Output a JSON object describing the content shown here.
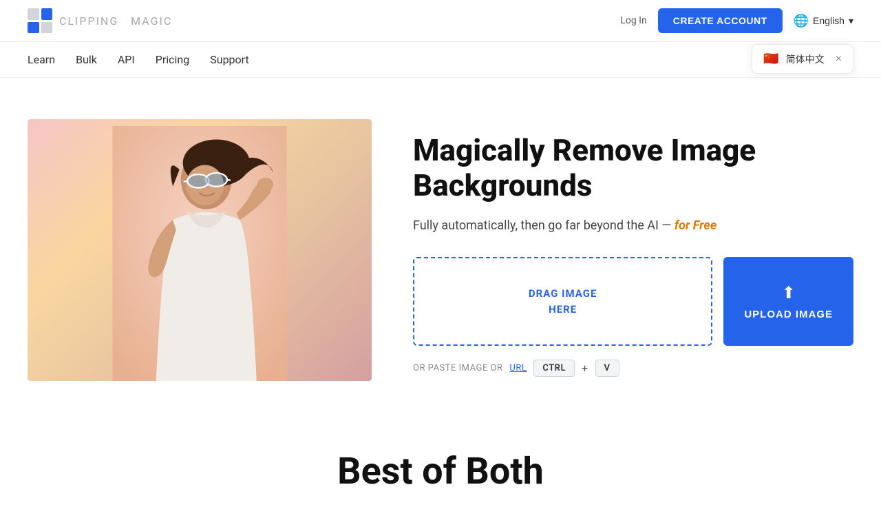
{
  "header": {
    "logo_brand": "CLIPPING",
    "logo_sub": "MAGIC",
    "login_label": "Log In",
    "create_account_label": "CREATE ACCOUNT",
    "language_label": "English",
    "lang_dropdown": {
      "flag": "🇨🇳",
      "option": "简体中文",
      "close": "×"
    }
  },
  "nav": {
    "items": [
      {
        "label": "Learn",
        "id": "learn"
      },
      {
        "label": "Bulk",
        "id": "bulk"
      },
      {
        "label": "API",
        "id": "api"
      },
      {
        "label": "Pricing",
        "id": "pricing"
      },
      {
        "label": "Support",
        "id": "support"
      }
    ]
  },
  "hero": {
    "title": "Magically Remove Image Backgrounds",
    "subtitle_pre": "Fully automatically, then go far beyond the AI — ",
    "subtitle_free": "for Free",
    "drag_label": "DRAG IMAGE\nHERE",
    "upload_label": "UPLOAD IMAGE",
    "paste_pre": "OR PASTE IMAGE OR",
    "paste_url": "URL",
    "ctrl_label": "CTRL",
    "plus_label": "+",
    "v_label": "V"
  },
  "bottom": {
    "best_of_both": "Best of Both"
  },
  "icons": {
    "upload": "⬆",
    "globe": "🌐",
    "chevron_down": "▾"
  }
}
